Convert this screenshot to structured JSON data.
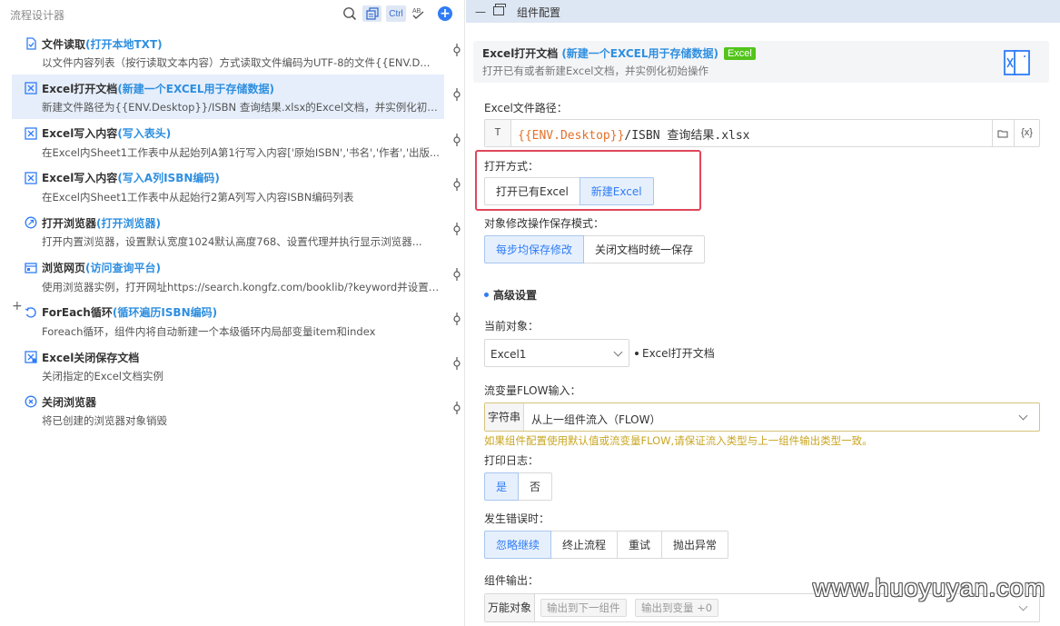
{
  "left_panel": {
    "title": "流程设计器",
    "toolbar": {
      "ctrl_label": "Ctrl",
      "ab_label": "AB",
      "add_label": "+"
    },
    "steps": [
      {
        "name": "文件读取",
        "tag": "(打开本地TXT)",
        "desc": "以文件内容列表（按行读取文本内容）方式读取文件编码为UTF-8的文件{{ENV.D...",
        "icon": "file-read-icon"
      },
      {
        "name": "Excel打开文档",
        "tag": "(新建一个EXCEL用于存储数据)",
        "desc": "新建文件路径为{{ENV.Desktop}}/ISBN 查询结果.xlsx的Excel文档，并实例化初始...",
        "icon": "excel-icon",
        "selected": true
      },
      {
        "name": "Excel写入内容",
        "tag": "(写入表头)",
        "desc": "在Excel内Sheet1工作表中从起始列A第1行写入内容['原始ISBN','书名','作者','出版...",
        "icon": "excel-icon"
      },
      {
        "name": "Excel写入内容",
        "tag": "(写入A列ISBN编码)",
        "desc": "在Excel内Sheet1工作表中从起始行2第A列写入内容ISBN编码列表",
        "icon": "excel-icon"
      },
      {
        "name": "打开浏览器",
        "tag": "(打开浏览器)",
        "desc": "打开内置浏览器，设置默认宽度1024默认高度768、设置代理并执行显示浏览器...",
        "icon": "browser-open-icon"
      },
      {
        "name": "浏览网页",
        "tag": "(访问查询平台)",
        "desc": "使用浏览器实例，打开网址https://search.kongfz.com/booklib/?keyword并设置Us...",
        "icon": "web-page-icon"
      },
      {
        "name": "ForEach循环",
        "tag": "(循环遍历ISBN编码)",
        "desc": "Foreach循环，组件内将自动新建一个本级循环内局部变量item和index",
        "icon": "foreach-icon"
      },
      {
        "name": "Excel关闭保存文档",
        "tag": "",
        "desc": "关闭指定的Excel文档实例",
        "icon": "excel-close-icon"
      },
      {
        "name": "关闭浏览器",
        "tag": "",
        "desc": "将已创建的浏览器对象销毁",
        "icon": "browser-close-icon"
      }
    ],
    "expand_label": "+"
  },
  "right_panel": {
    "header": {
      "min_label": "—",
      "title": "组件配置"
    },
    "card": {
      "name": "Excel打开文档",
      "tag": "(新建一个EXCEL用于存储数据)",
      "badge": "Excel",
      "desc": "打开已有或者新建Excel文档，并实例化初始操作"
    },
    "path": {
      "label": "Excel文件路径：",
      "type": "T",
      "env": "{{ENV.Desktop}}",
      "rest": "/ISBN 查询结果.xlsx",
      "var_button": "{x}"
    },
    "open_mode": {
      "label": "打开方式：",
      "options": [
        "打开已有Excel",
        "新建Excel"
      ],
      "selected": "新建Excel"
    },
    "save_mode": {
      "label": "对象修改操作保存模式：",
      "options": [
        "每步均保存修改",
        "关闭文档时统一保存"
      ],
      "selected": "每步均保存修改"
    },
    "advanced": {
      "title": "高级设置"
    },
    "current_object": {
      "label": "当前对象：",
      "value": "Excel1",
      "note": "Excel打开文档"
    },
    "flow_input": {
      "label": "流变量FLOW输入：",
      "type": "字符串",
      "value": "从上一组件流入（FLOW）",
      "hint": "如果组件配置使用默认值或流变量FLOW,请保证流入类型与上一组件输出类型一致。"
    },
    "print_log": {
      "label": "打印日志：",
      "options": [
        "是",
        "否"
      ],
      "selected": "是"
    },
    "on_error": {
      "label": "发生错误时：",
      "options": [
        "忽略继续",
        "终止流程",
        "重试",
        "抛出异常"
      ],
      "selected": "忽略继续"
    },
    "output": {
      "label": "组件输出：",
      "type": "万能对象",
      "chip1": "输出到下一组件",
      "chip2": "输出到变量 +0"
    }
  },
  "watermark": "www.huoyuyan.com",
  "colors": {
    "accent": "#2f7cf6",
    "tag": "#2f8fe0",
    "highlight": "#e0475a",
    "hint": "#c9a521",
    "badge": "#52c41a"
  }
}
